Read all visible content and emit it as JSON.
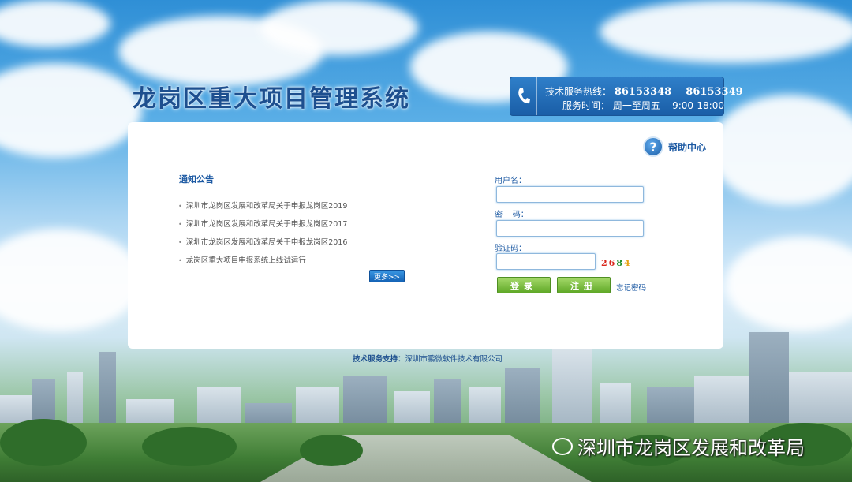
{
  "header": {
    "title": "龙岗区重大项目管理系统",
    "hotline_label": "技术服务热线：",
    "hotline_numbers": "86153348    86153349",
    "hours_label": "服务时间：",
    "hours_value": "周一至周五    9:00-18:00"
  },
  "help": {
    "label": "帮助中心"
  },
  "notice": {
    "title": "通知公告",
    "items": [
      "深圳市龙岗区发展和改革局关于申报龙岗区2019",
      "深圳市龙岗区发展和改革局关于申报龙岗区2017",
      "深圳市龙岗区发展和改革局关于申报龙岗区2016",
      "龙岗区重大项目申报系统上线试运行"
    ],
    "more_label": "更多>>"
  },
  "login": {
    "username_label": "用户名：",
    "username_value": "",
    "password_label": "密    码：",
    "password_value": "",
    "captcha_label": "验证码：",
    "captcha_value": "",
    "captcha_digits": [
      "2",
      "6",
      "8",
      "4"
    ],
    "captcha_colors": [
      "#d9261c",
      "#d9261c",
      "#1f8f2d",
      "#e8a317"
    ],
    "login_label": "登录",
    "register_label": "注册",
    "forgot_label": "忘记密码"
  },
  "footer": {
    "support_label": "技术服务支持：",
    "support_company": "深圳市鹏微软件技术有限公司"
  },
  "watermark": {
    "text": "深圳市龙岗区发展和改革局"
  },
  "icons": [
    "phone-icon",
    "help-icon",
    "wechat-icon"
  ]
}
